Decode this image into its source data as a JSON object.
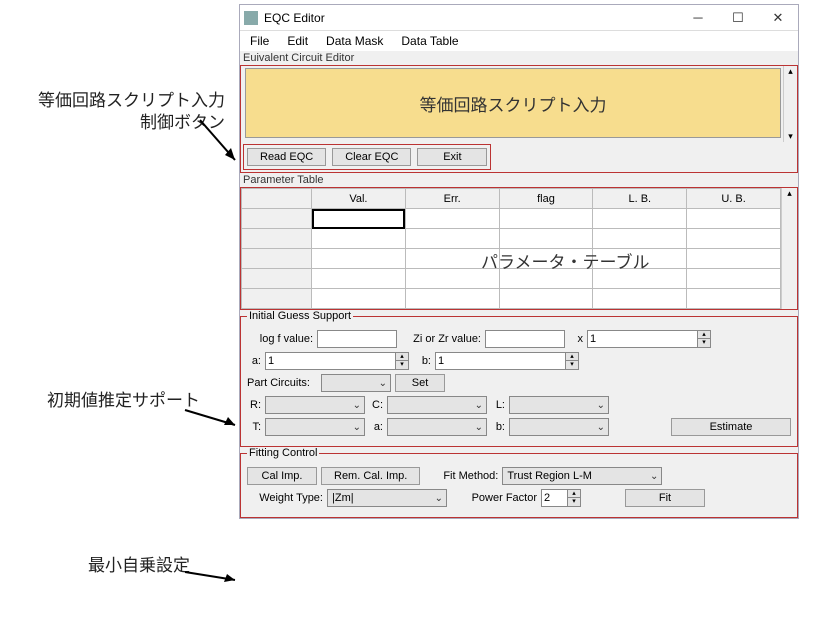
{
  "window": {
    "title": "EQC Editor"
  },
  "menu": {
    "file": "File",
    "edit": "Edit",
    "dataMask": "Data Mask",
    "dataTable": "Data Table"
  },
  "annotations": {
    "scriptInput": "等価回路スクリプト入力",
    "controlButtons": "制御ボタン",
    "paramTable": "パラメータ・テーブル",
    "initialGuess": "初期値推定サポート",
    "fitting": "最小自乗設定"
  },
  "script": {
    "label": "Euivalent Circuit Editor",
    "placeholder": "等価回路スクリプト入力",
    "buttons": {
      "read": "Read EQC",
      "clear": "Clear EQC",
      "exit": "Exit"
    }
  },
  "paramTable": {
    "label": "Parameter Table",
    "cols": {
      "val": "Val.",
      "err": "Err.",
      "flag": "flag",
      "lb": "L. B.",
      "ub": "U. B."
    }
  },
  "guess": {
    "label": "Initial Guess Support",
    "logf": "log f value:",
    "zizr": "Zi or Zr value:",
    "xlbl": "x",
    "xval": "1",
    "a": "a:",
    "aval": "1",
    "b": "b:",
    "bval": "1",
    "part": "Part Circuits:",
    "set": "Set",
    "R": "R:",
    "C": "C:",
    "L": "L:",
    "T": "T:",
    "a2": "a:",
    "b2": "b:",
    "estimate": "Estimate"
  },
  "fit": {
    "label": "Fitting Control",
    "calImp": "Cal Imp.",
    "remCalImp": "Rem. Cal. Imp.",
    "fitMethodLbl": "Fit Method:",
    "fitMethod": "Trust Region L-M",
    "weightTypeLbl": "Weight Type:",
    "weightType": "|Zm|",
    "powerFactorLbl": "Power Factor",
    "powerFactor": "2",
    "fitBtn": "Fit"
  }
}
